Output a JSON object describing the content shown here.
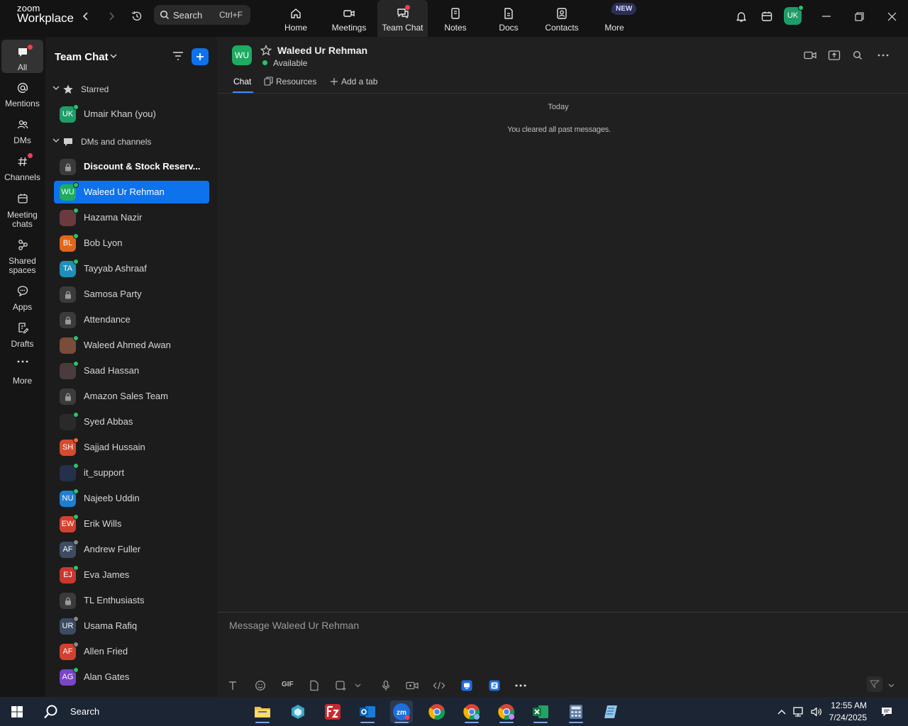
{
  "app": {
    "logo_line1": "zoom",
    "logo_line2": "Workplace"
  },
  "topbar": {
    "search_label": "Search",
    "search_shortcut": "Ctrl+F",
    "tabs": [
      {
        "label": "Home",
        "icon": "home-icon"
      },
      {
        "label": "Meetings",
        "icon": "video-camera-icon"
      },
      {
        "label": "Team Chat",
        "icon": "chat-bubbles-icon",
        "active": true
      },
      {
        "label": "Notes",
        "icon": "notes-icon"
      },
      {
        "label": "Docs",
        "icon": "document-icon"
      },
      {
        "label": "Contacts",
        "icon": "contacts-icon"
      },
      {
        "label": "More",
        "icon": "more-dots-icon"
      }
    ],
    "new_badge": "NEW",
    "user_initials": "UK"
  },
  "rail": {
    "items": [
      {
        "label": "All",
        "icon": "chat-icon",
        "active": true
      },
      {
        "label": "Mentions",
        "icon": "at-sign-icon"
      },
      {
        "label": "DMs",
        "icon": "people-icon"
      },
      {
        "label": "Channels",
        "icon": "hash-icon"
      },
      {
        "label": "Meeting chats",
        "icon": "calendar-icon"
      },
      {
        "label": "Shared spaces",
        "icon": "shared-spaces-icon"
      },
      {
        "label": "Apps",
        "icon": "apps-icon"
      },
      {
        "label": "Drafts",
        "icon": "drafts-icon"
      },
      {
        "label": "More",
        "icon": "more-icon"
      }
    ]
  },
  "panel": {
    "title": "Team Chat",
    "sections": {
      "starred": "Starred",
      "dms": "DMs and channels"
    },
    "starred": [
      {
        "initials": "UK",
        "name": "Umair Khan (you)",
        "color": "#1f9d68",
        "presence": "#2ac46a"
      }
    ],
    "contacts": [
      {
        "initials": "",
        "name": "Discount & Stock Reserv...",
        "type": "lock",
        "bold": true
      },
      {
        "initials": "WU",
        "name": "Waleed Ur Rehman",
        "color": "#1eab62",
        "presence": "#2ac46a",
        "selected": true
      },
      {
        "initials": "",
        "name": "Hazama Nazir",
        "color": "#6b3a3f",
        "presence": "#2ac46a"
      },
      {
        "initials": "BL",
        "name": "Bob Lyon",
        "color": "#e2661a",
        "presence": "#2ac46a"
      },
      {
        "initials": "TA",
        "name": "Tayyab Ashraaf",
        "color": "#1e8fb8",
        "presence": "#2ac46a"
      },
      {
        "initials": "",
        "name": "Samosa Party",
        "type": "lock"
      },
      {
        "initials": "",
        "name": "Attendance",
        "type": "lock"
      },
      {
        "initials": "",
        "name": "Waleed Ahmed Awan",
        "color": "#7a4c3a",
        "presence": "#2ac46a"
      },
      {
        "initials": "",
        "name": "Saad Hassan",
        "color": "#4a3c3c",
        "presence": "#2ac46a"
      },
      {
        "initials": "",
        "name": "Amazon Sales Team",
        "type": "lock"
      },
      {
        "initials": "",
        "name": "Syed Abbas",
        "color": "#2a2a2a",
        "presence": "#2ac46a"
      },
      {
        "initials": "SH",
        "name": "Sajjad Hussain",
        "color": "#d84a2f",
        "presence": "#f0682a"
      },
      {
        "initials": "",
        "name": "it_support",
        "color": "#25304a",
        "presence": "#2ac46a"
      },
      {
        "initials": "NU",
        "name": "Najeeb Uddin",
        "color": "#1e7fd0",
        "presence": "#2ac46a"
      },
      {
        "initials": "EW",
        "name": "Erik Wills",
        "color": "#d3402f",
        "presence": "#2ac46a"
      },
      {
        "initials": "AF",
        "name": "Andrew Fuller",
        "color": "#3d4c63",
        "presence": "#8a8a8a"
      },
      {
        "initials": "EJ",
        "name": "Eva James",
        "color": "#c8382f",
        "presence": "#2ac46a"
      },
      {
        "initials": "",
        "name": "TL Enthusiasts",
        "type": "lock"
      },
      {
        "initials": "UR",
        "name": "Usama Rafiq",
        "color": "#3d4c63",
        "presence": "#8a8a8a"
      },
      {
        "initials": "AF",
        "name": "Allen Fried",
        "color": "#d3402f",
        "presence": "#8a8a8a"
      },
      {
        "initials": "AG",
        "name": "Alan Gates",
        "color": "#7a45c9",
        "presence": "#2ac46a"
      }
    ]
  },
  "chat": {
    "initials": "WU",
    "name": "Waleed Ur Rehman",
    "status": "Available",
    "tabs": [
      "Chat",
      "Resources",
      "Add a tab"
    ],
    "day_label": "Today",
    "system_message": "You cleared all past messages.",
    "composer_placeholder": "Message Waleed Ur Rehman",
    "gif_label": "GIF"
  },
  "taskbar": {
    "search_label": "Search",
    "time": "12:55 AM",
    "date": "7/24/2025"
  },
  "colors": {
    "accent": "#0e72ed",
    "presence_available": "#2ac46a",
    "notification": "#f23d4f"
  }
}
